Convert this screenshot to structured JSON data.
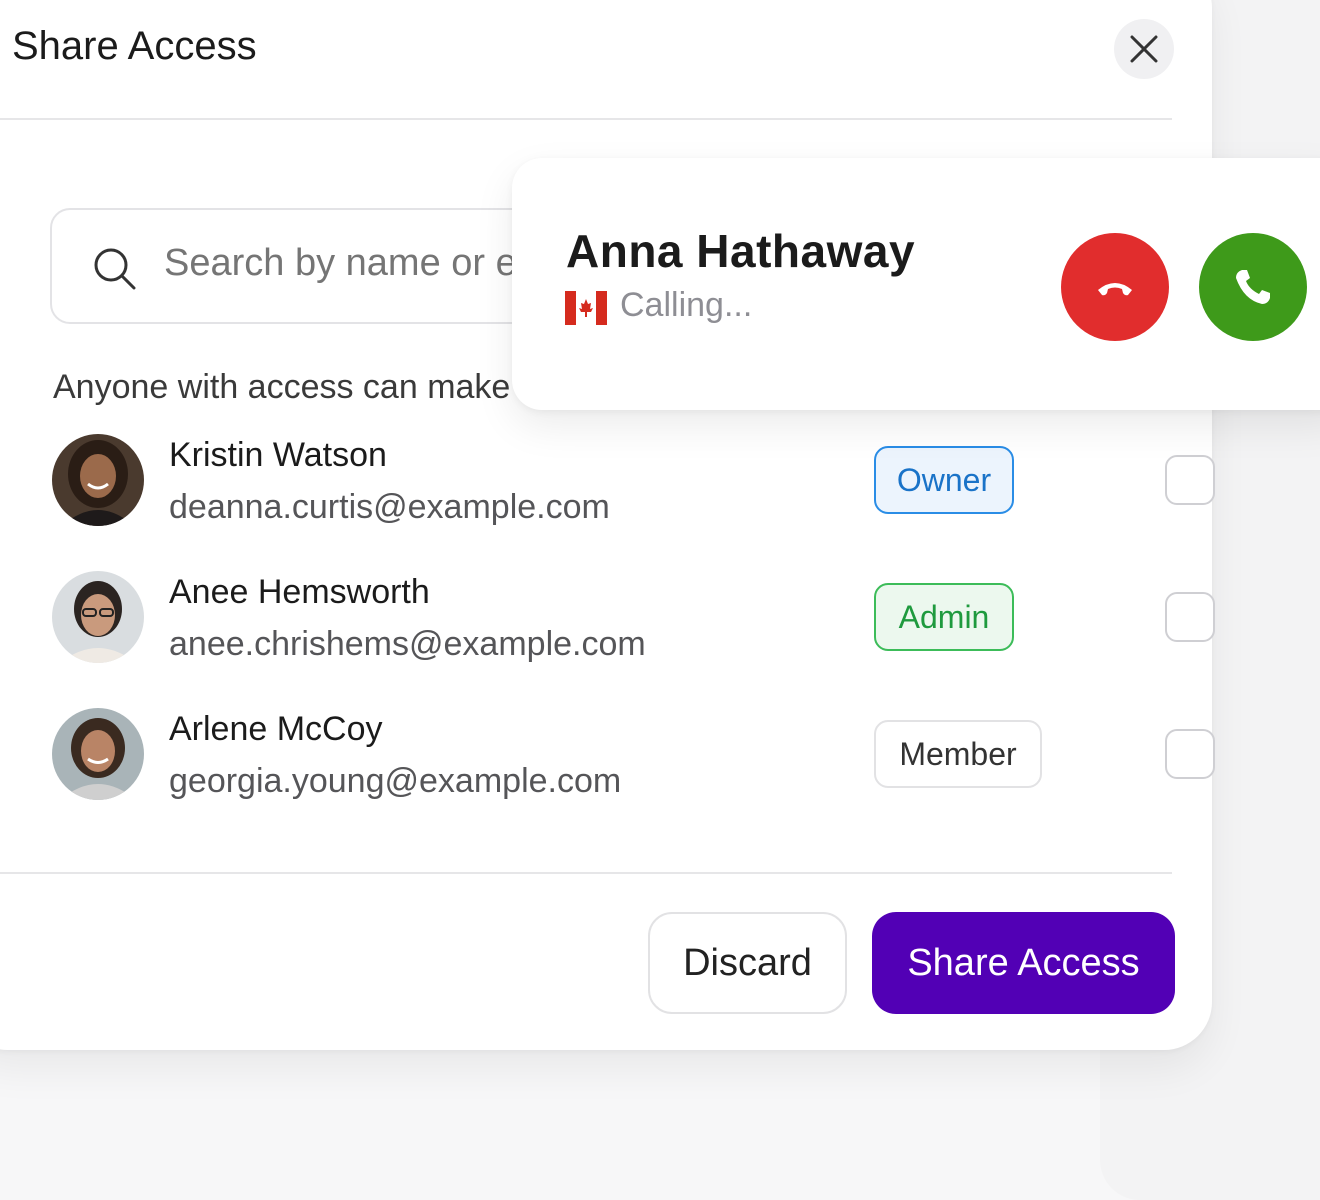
{
  "dialog": {
    "title": "Share Access",
    "close_icon": "close-icon"
  },
  "search": {
    "placeholder": "Search by name or email",
    "icon": "search-icon"
  },
  "hint": "Anyone with access can make o",
  "members": [
    {
      "name": "Kristin Watson",
      "email": "deanna.curtis@example.com",
      "role": "Owner"
    },
    {
      "name": "Anee Hemsworth",
      "email": "anee.chrishems@example.com",
      "role": "Admin"
    },
    {
      "name": "Arlene McCoy",
      "email": "georgia.young@example.com",
      "role": "Member"
    }
  ],
  "footer": {
    "discard_label": "Discard",
    "share_label": "Share Access"
  },
  "call": {
    "caller_name": "Anna Hathaway",
    "status": "Calling...",
    "flag_icon": "canada-flag-icon",
    "decline_icon": "phone-decline-icon",
    "accept_icon": "phone-accept-icon"
  },
  "colors": {
    "primary": "#5200b5",
    "owner": "#2a8de6",
    "admin": "#3cbc59",
    "decline": "#e12d2d",
    "accept": "#3e9a1a"
  }
}
